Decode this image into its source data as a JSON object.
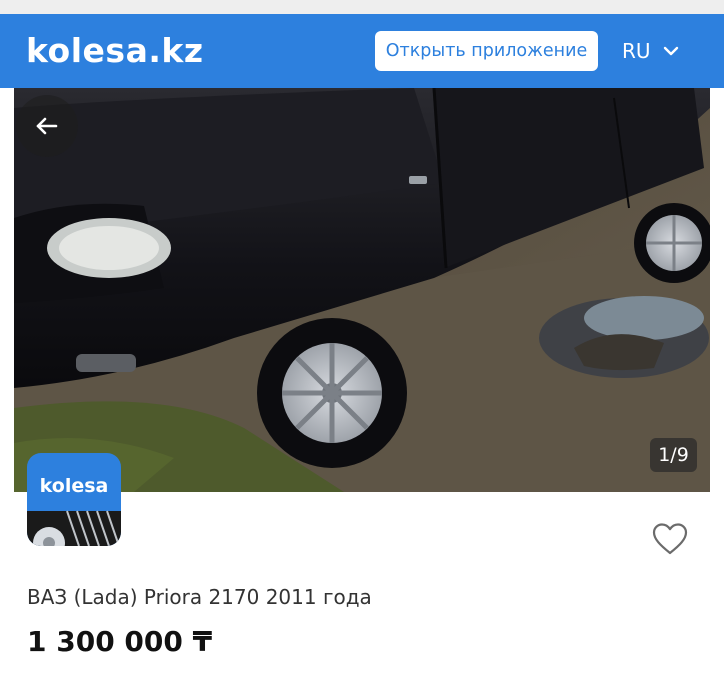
{
  "header": {
    "logo_text": "kolesa.kz",
    "open_app_label": "Открыть приложение",
    "language": "RU",
    "bg_color": "#2d80de"
  },
  "gallery": {
    "counter": "1/9",
    "back_icon": "arrow-left-icon",
    "current_index": 1,
    "total": 9
  },
  "seller": {
    "logo_text": "kolesa",
    "logo_icon": "tire-icon"
  },
  "listing": {
    "title": "ВАЗ (Lada) Priora 2170 2011 года",
    "price": "1 300 000 ₸",
    "favorite_icon": "heart-outline-icon"
  }
}
